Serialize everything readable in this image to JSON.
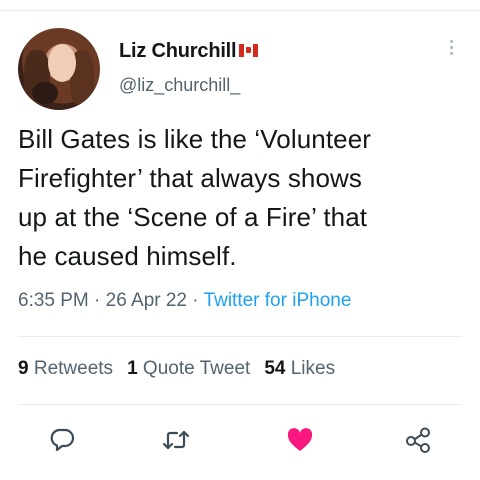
{
  "author": {
    "name": "Liz Churchill",
    "handle": "@liz_churchill_"
  },
  "tweet": {
    "lines": [
      "Bill Gates is like the ‘Volunteer",
      "Firefighter’ that always shows",
      "up at the ‘Scene of a Fire’ that",
      "he caused himself."
    ]
  },
  "meta": {
    "time": "6:35 PM",
    "sep1": " · ",
    "date": "26 Apr 22",
    "sep2": " · ",
    "source": "Twitter for iPhone"
  },
  "stats": {
    "retweets_count": "9",
    "retweets_label": "Retweets",
    "quotes_count": "1",
    "quotes_label": "Quote Tweet",
    "likes_count": "54",
    "likes_label": "Likes"
  },
  "actions": {
    "reply_icon": "reply-icon",
    "retweet_icon": "retweet-icon",
    "like_icon": "heart-icon",
    "share_icon": "share-icon",
    "liked": true
  },
  "colors": {
    "text": "#14171a",
    "secondary": "#536471",
    "link": "#1da1f2",
    "like": "#f91880",
    "icon": "#3c4b57",
    "divider": "#e6ecf0"
  }
}
